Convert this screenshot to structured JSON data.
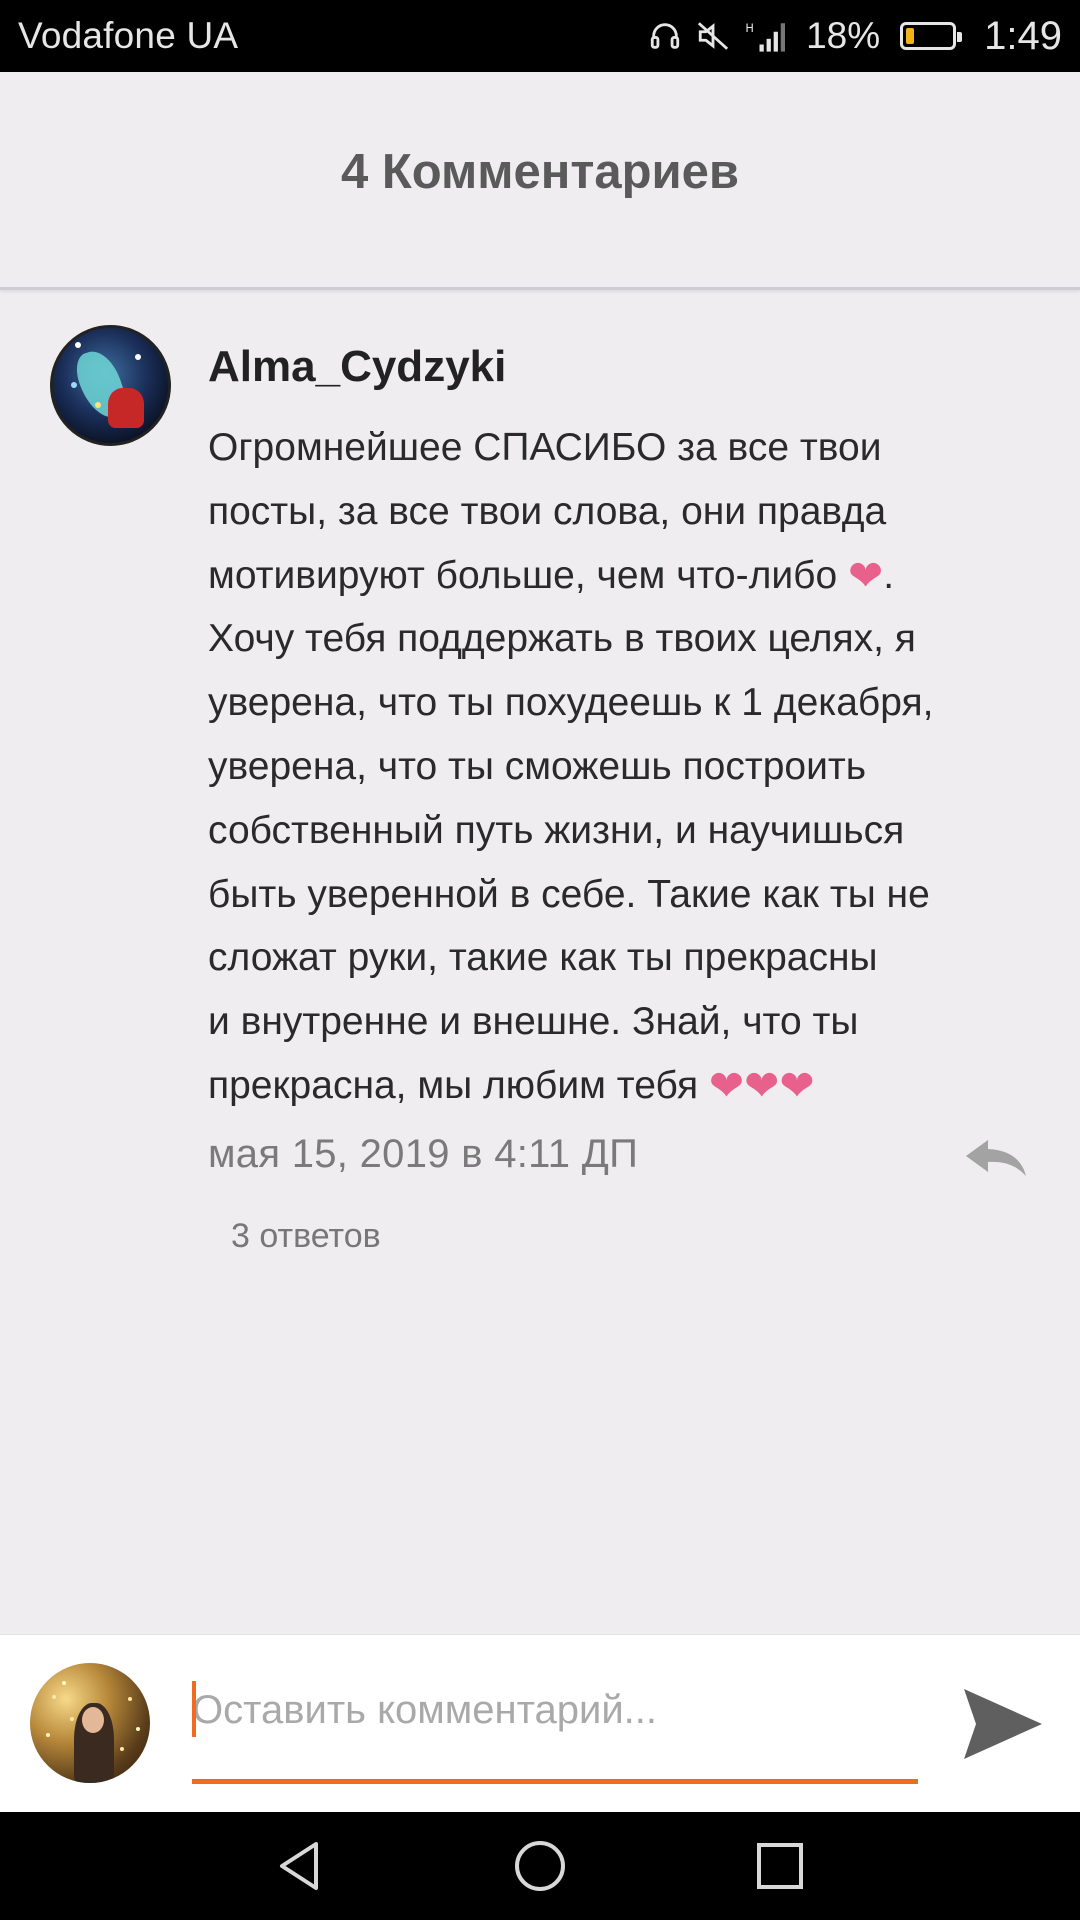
{
  "status_bar": {
    "carrier": "Vodafone UA",
    "battery_percent": "18%",
    "battery_level": 0.18,
    "time": "1:49",
    "icons": [
      "headphones-icon",
      "vibrate-off-icon",
      "signal-icon",
      "battery-icon"
    ]
  },
  "header": {
    "title": "4 Комментариев"
  },
  "comment": {
    "author": "Alma_Cydzyki",
    "body_lines": [
      "Огромнейшее СПАСИБО за все твои",
      "посты, за все твои слова, они правда",
      "мотивируют больше, чем что-либо ",
      "Хочу тебя поддержать в твоих целях, я",
      "уверена, что ты похудеешь к 1 декабря,",
      "уверена, что ты сможешь построить",
      "собственный путь жизни, и научишься",
      "быть уверенной в себе. Такие как ты не",
      "сложат руки, такие как ты прекрасны",
      "и внутренне и внешне. Знай, что ты",
      "прекрасна, мы любим тебя "
    ],
    "line3_suffix": ".",
    "heart_emoji": "❤",
    "heart_color": "#e8608c",
    "date": "мая 15, 2019 в 4:11 ДП",
    "replies": "3 ответов"
  },
  "input": {
    "placeholder": "Оставить комментарий...",
    "value": "",
    "accent_color": "#ee6b21"
  },
  "nav": {
    "icons": [
      "back-icon",
      "home-icon",
      "recents-icon"
    ]
  }
}
